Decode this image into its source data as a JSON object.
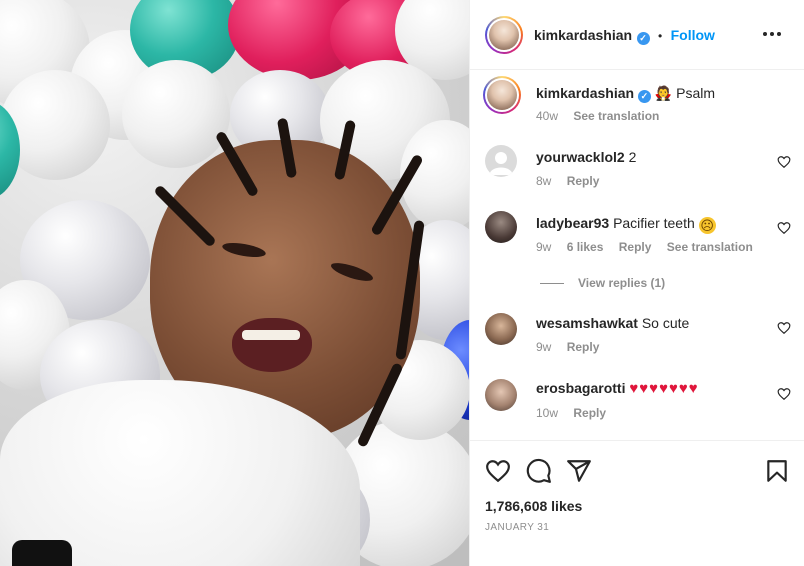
{
  "post": {
    "author": "kimkardashian",
    "follow_label": "Follow",
    "separator": "•",
    "verified_symbol": "✓"
  },
  "caption": {
    "username": "kimkardashian",
    "emoji": "🧛",
    "text": "Psalm",
    "age": "40w",
    "see_translation": "See translation"
  },
  "comments": [
    {
      "username": "yourwacklol2",
      "text": "2",
      "age": "8w",
      "reply": "Reply"
    },
    {
      "username": "ladybear93",
      "text": "Pacifier teeth",
      "emoji": "☹",
      "age": "9w",
      "likes": "6 likes",
      "reply": "Reply",
      "see_translation": "See translation"
    },
    {
      "username": "wesamshawkat",
      "text": "So cute",
      "age": "9w",
      "reply": "Reply"
    },
    {
      "username": "erosbagarotti",
      "text": "♥♥♥♥♥♥♥",
      "age": "10w",
      "reply": "Reply"
    }
  ],
  "view_replies": "View replies (1)",
  "likes_count": "1,786,608 likes",
  "date": "JANUARY 31",
  "colors": {
    "link_blue": "#0095f6",
    "verified_blue": "#3897f0",
    "heart_red": "#e0163b",
    "muted_gray": "#8e8e8e",
    "text_dark": "#262626"
  },
  "icons": {
    "header_more": "more-horizontal-icon",
    "like": "heart-outline-icon",
    "comment": "comment-bubble-icon",
    "share": "paper-plane-icon",
    "save": "bookmark-icon",
    "comment_like": "heart-small-icon"
  }
}
